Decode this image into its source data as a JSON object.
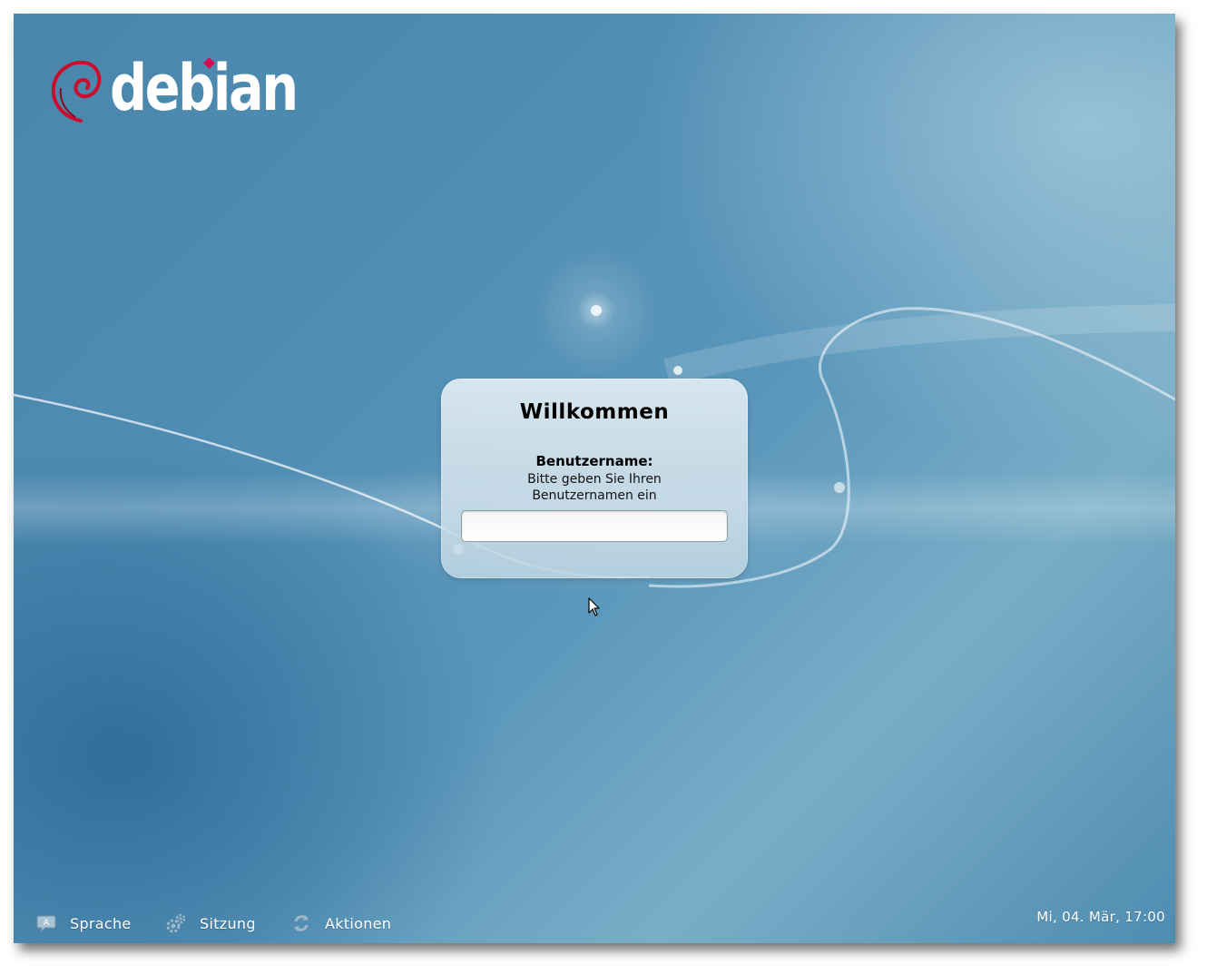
{
  "brand": {
    "name": "debian",
    "accent_color": "#d70a53"
  },
  "login": {
    "greeting": "Willkommen",
    "username_label": "Benutzername:",
    "username_hint": "Bitte geben Sie Ihren Benutzernamen ein",
    "username_value": ""
  },
  "bottom_bar": {
    "items": [
      {
        "label": "Sprache",
        "icon": "language-icon"
      },
      {
        "label": "Sitzung",
        "icon": "session-icon"
      },
      {
        "label": "Aktionen",
        "icon": "actions-icon"
      }
    ],
    "clock": "Mi, 04. Mär, 17:00"
  },
  "colors": {
    "background_blue": "#4f8db3",
    "panel": "#d3e3ec",
    "text": "#ffffff"
  }
}
